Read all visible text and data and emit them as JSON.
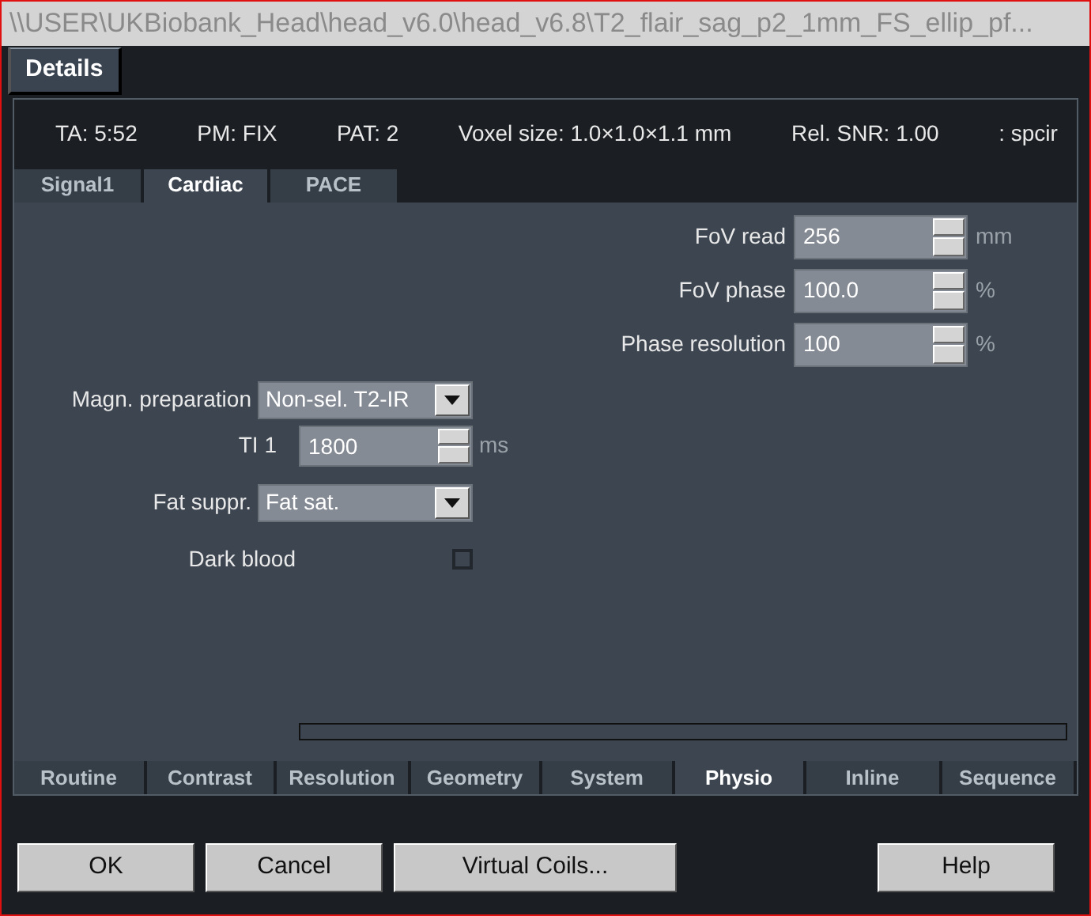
{
  "window": {
    "title": "\\\\USER\\UKBiobank_Head\\head_v6.0\\head_v6.8\\T2_flair_sag_p2_1mm_FS_ellip_pf..."
  },
  "details_tab": {
    "label": "Details",
    "selected": true
  },
  "info": [
    "TA: 5:52",
    "PM: FIX",
    "PAT: 2",
    "Voxel size: 1.0×1.0×1.1 mm",
    "Rel. SNR: 1.00",
    ": spcir"
  ],
  "top_tabs": [
    {
      "label": "Signal1",
      "selected": false
    },
    {
      "label": "Cardiac",
      "selected": true
    },
    {
      "label": "PACE",
      "selected": false
    }
  ],
  "right_params": [
    {
      "label": "FoV read",
      "value": "256",
      "unit": "mm"
    },
    {
      "label": "FoV phase",
      "value": "100.0",
      "unit": "%"
    },
    {
      "label": "Phase resolution",
      "value": "100",
      "unit": "%"
    }
  ],
  "magn_preparation": {
    "label": "Magn. preparation",
    "value": "Non-sel. T2-IR"
  },
  "ti": {
    "label": "TI 1",
    "value": "1800",
    "unit": "ms"
  },
  "fat_suppr": {
    "label": "Fat suppr.",
    "value": "Fat sat."
  },
  "dark_blood": {
    "label": "Dark blood",
    "checked": false
  },
  "bottom_tabs": [
    {
      "label": "Routine",
      "selected": false
    },
    {
      "label": "Contrast",
      "selected": false
    },
    {
      "label": "Resolution",
      "selected": false
    },
    {
      "label": "Geometry",
      "selected": false
    },
    {
      "label": "System",
      "selected": false
    },
    {
      "label": "Physio",
      "selected": true
    },
    {
      "label": "Inline",
      "selected": false
    },
    {
      "label": "Sequence",
      "selected": false
    }
  ],
  "buttons": [
    {
      "label": "OK"
    },
    {
      "label": "Cancel"
    },
    {
      "label": "Virtual Coils..."
    },
    {
      "label": "Help"
    }
  ]
}
